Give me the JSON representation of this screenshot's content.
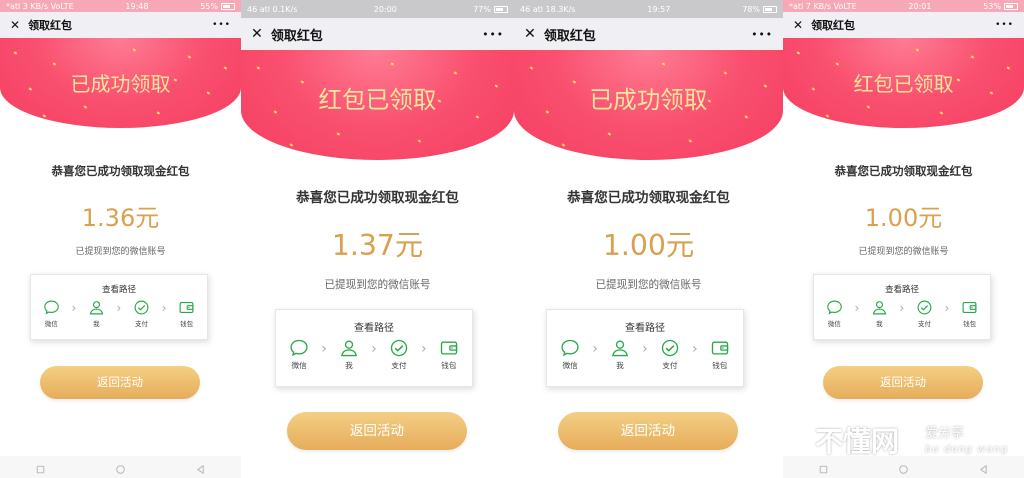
{
  "icons": {
    "close": "close-icon",
    "more": "more-icon",
    "path_steps": [
      "chat-bubble-icon",
      "person-icon",
      "check-circle-icon",
      "wallet-icon"
    ],
    "sysnav": [
      "square-icon",
      "circle-icon",
      "triangle-back-icon"
    ]
  },
  "colors": {
    "banner": "#f53e62",
    "banner_title": "#fbe59b",
    "amount": "#d9a14e",
    "button": "#e6ac5b",
    "step_icon": "#27a84a"
  },
  "phones": [
    {
      "status": {
        "left": "*atl 3 KB/s VoLTE",
        "time": "19:48",
        "right": "55%"
      },
      "nav_title": "领取红包",
      "banner_title": "已成功领取",
      "congrats": "恭喜您已成功领取现金红包",
      "amount": "1.36元",
      "note": "已提现到您的微信账号",
      "path_title": "查看路径",
      "steps": [
        "微信",
        "我",
        "支付",
        "钱包"
      ],
      "button": "返回活动"
    },
    {
      "status": {
        "left": "46 atl 0.1K/s",
        "time": "20:00",
        "right": "77%"
      },
      "nav_title": "领取红包",
      "banner_title": "红包已领取",
      "congrats": "恭喜您已成功领取现金红包",
      "amount": "1.37元",
      "note": "已提现到您的微信账号",
      "path_title": "查看路径",
      "steps": [
        "微信",
        "我",
        "支付",
        "钱包"
      ],
      "button": "返回活动"
    },
    {
      "status": {
        "left": "46 atl 18.3K/s",
        "time": "19:57",
        "right": "78%"
      },
      "nav_title": "领取红包",
      "banner_title": "已成功领取",
      "congrats": "恭喜您已成功领取现金红包",
      "amount": "1.00元",
      "note": "已提现到您的微信账号",
      "path_title": "查看路径",
      "steps": [
        "微信",
        "我",
        "支付",
        "钱包"
      ],
      "button": "返回活动"
    },
    {
      "status": {
        "left": "*atl 7 KB/s VoLTE",
        "time": "20:01",
        "right": "53%"
      },
      "nav_title": "领取红包",
      "banner_title": "红包已领取",
      "congrats": "恭喜您已成功领取现金红包",
      "amount": "1.00元",
      "note": "已提现到您的微信账号",
      "path_title": "查看路径",
      "steps": [
        "微信",
        "我",
        "支付",
        "钱包"
      ],
      "button": "返回活动"
    }
  ],
  "watermark": {
    "big": "不懂网",
    "small": "爱分享",
    "latin": "bu dong wang"
  }
}
